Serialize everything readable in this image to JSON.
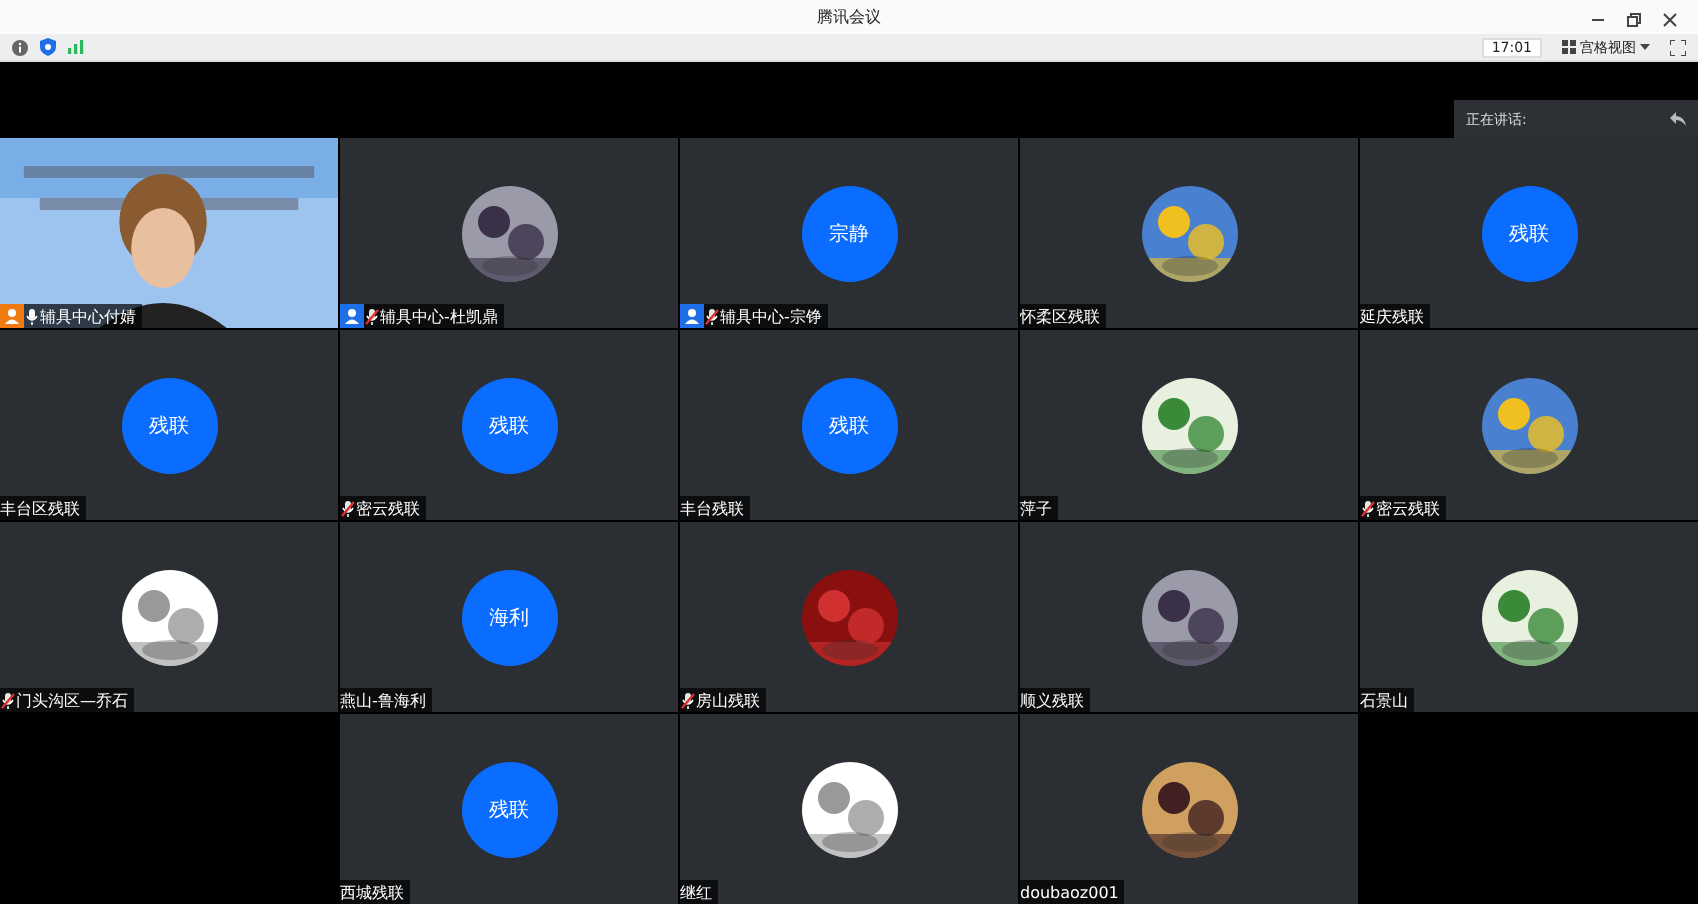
{
  "window": {
    "title": "腾讯会议"
  },
  "toolbar": {
    "time": "17:01",
    "view": "宫格视图"
  },
  "speaking": {
    "label": "正在讲话:"
  },
  "tiles": [
    {
      "kind": "video",
      "name": "辅具中心付婧",
      "badge": true,
      "color": "#f07a10",
      "mic_icon": true,
      "muted": false
    },
    {
      "name": "辅具中心-杜凯鼎",
      "badge": true,
      "color": "#1e6fe8",
      "mic_icon": true,
      "muted": true
    },
    {
      "kind": "initials",
      "avatar": "宗静",
      "name": "辅具中心-宗铮",
      "badge": true,
      "color": "#1e6fe8",
      "mic_icon": true,
      "muted": true
    },
    {
      "name": "怀柔区残联",
      "badge": false,
      "mic_icon": false
    },
    {
      "kind": "initials",
      "avatar": "残联",
      "name": "延庆残联",
      "badge": false,
      "mic_icon": false
    },
    {
      "kind": "initials",
      "avatar": "残联",
      "name": "丰台区残联",
      "badge": false,
      "mic_icon": false
    },
    {
      "kind": "initials",
      "avatar": "残联",
      "name": "密云残联",
      "badge": false,
      "mic_icon": true,
      "muted": true
    },
    {
      "kind": "initials",
      "avatar": "残联",
      "name": "丰台残联",
      "badge": false,
      "mic_icon": false
    },
    {
      "name": "萍子",
      "badge": false,
      "mic_icon": false
    },
    {
      "name": "密云残联",
      "badge": false,
      "mic_icon": true,
      "muted": true
    },
    {
      "name": "门头沟区—乔石",
      "badge": false,
      "mic_icon": true,
      "muted": true
    },
    {
      "kind": "initials",
      "avatar": "海利",
      "name": "燕山-鲁海利",
      "badge": false,
      "mic_icon": false
    },
    {
      "name": "房山残联",
      "badge": false,
      "mic_icon": true,
      "muted": true
    },
    {
      "name": "顺义残联",
      "badge": false,
      "mic_icon": false
    },
    {
      "name": "石景山",
      "badge": false,
      "mic_icon": false
    },
    {
      "kind": "initials",
      "avatar": "残联",
      "name": "西城残联",
      "badge": false,
      "mic_icon": false
    },
    {
      "name": "继红",
      "badge": false,
      "mic_icon": false
    },
    {
      "name": "doubaoz001",
      "badge": false,
      "mic_icon": false
    }
  ]
}
